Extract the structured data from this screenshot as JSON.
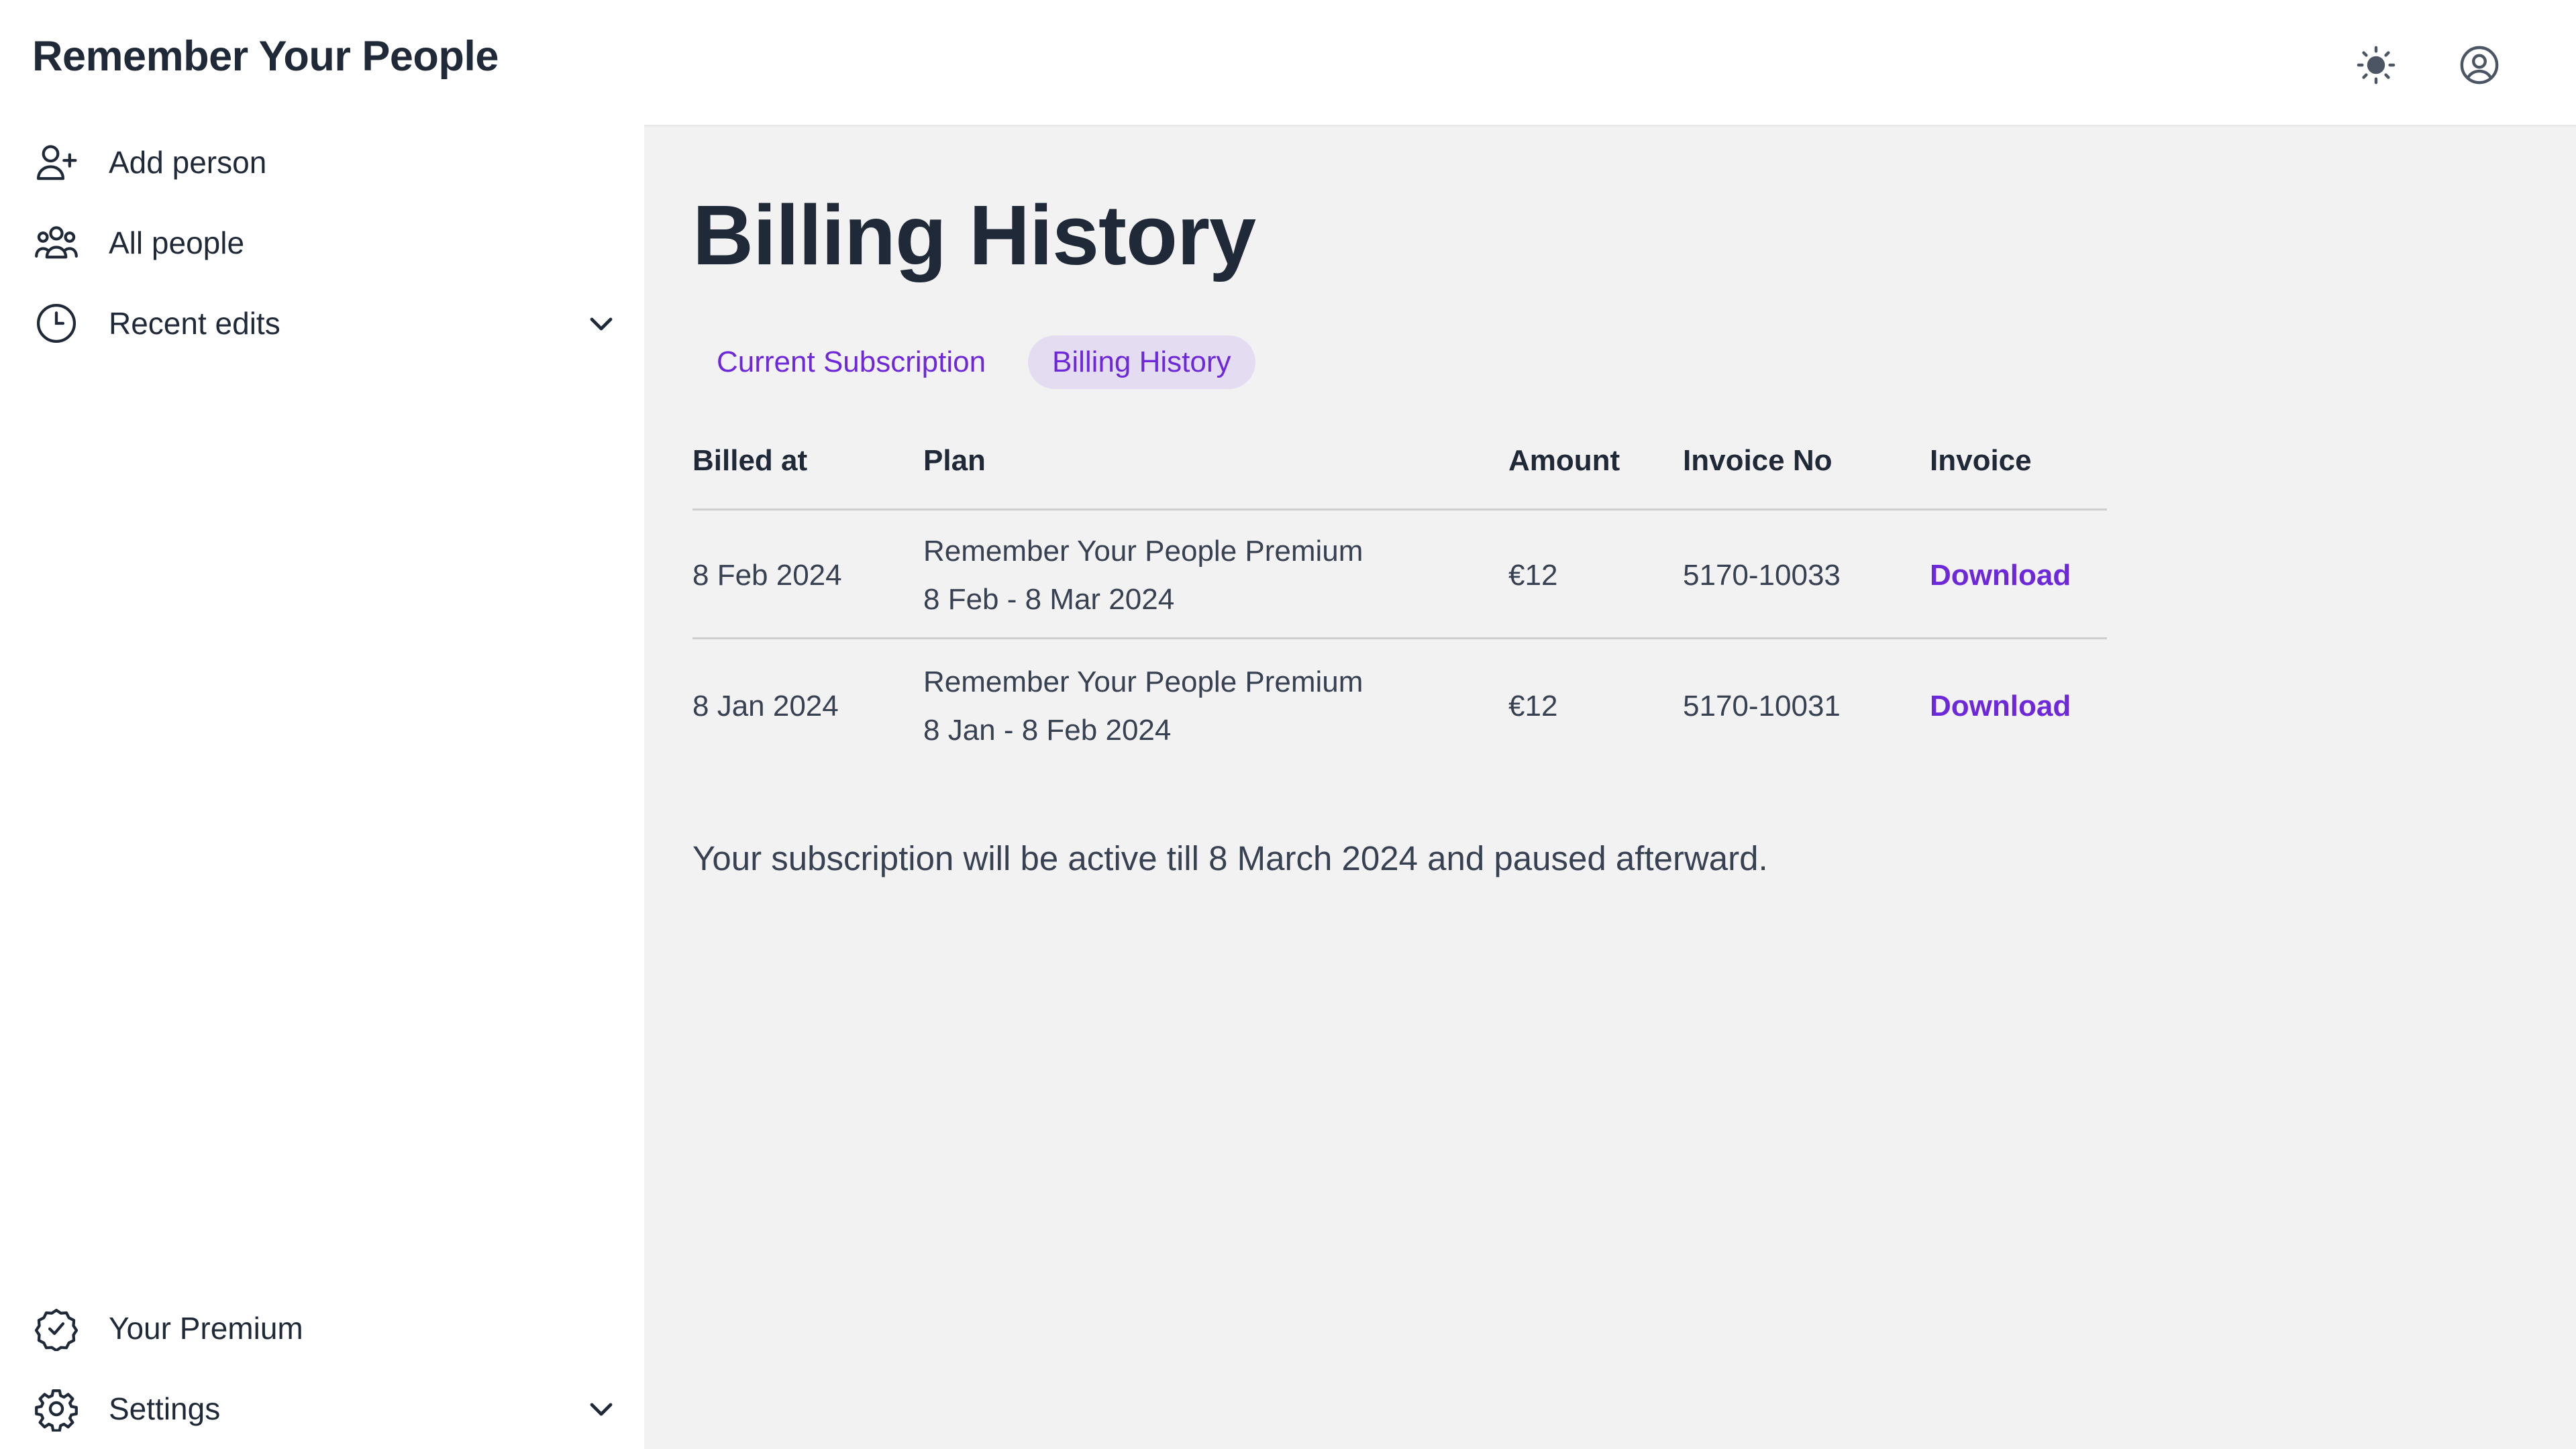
{
  "app": {
    "title": "Remember Your People"
  },
  "header": {
    "icons": [
      "sun-icon",
      "user-circle-icon"
    ]
  },
  "sidebar": {
    "items": [
      {
        "label": "Add person",
        "icon": "user-plus-icon"
      },
      {
        "label": "All people",
        "icon": "users-icon"
      },
      {
        "label": "Recent edits",
        "icon": "clock-icon",
        "expandable": true
      }
    ],
    "bottom_items": [
      {
        "label": "Your Premium",
        "icon": "check-badge-icon"
      },
      {
        "label": "Settings",
        "icon": "gear-icon",
        "expandable": true
      }
    ]
  },
  "main": {
    "title": "Billing History",
    "tabs": [
      {
        "label": "Current Subscription",
        "active": false
      },
      {
        "label": "Billing History",
        "active": true
      }
    ],
    "table": {
      "headers": [
        "Billed at",
        "Plan",
        "Amount",
        "Invoice No",
        "Invoice"
      ],
      "rows": [
        {
          "billed_at": "8 Feb 2024",
          "plan_name": "Remember Your People Premium",
          "plan_period": "8 Feb - 8 Mar 2024",
          "amount": "€12",
          "invoice_no": "5170-10033",
          "invoice": "Download"
        },
        {
          "billed_at": "8 Jan 2024",
          "plan_name": "Remember Your People Premium",
          "plan_period": "8 Jan - 8 Feb 2024",
          "amount": "€12",
          "invoice_no": "5170-10031",
          "invoice": "Download"
        }
      ]
    },
    "notice": "Your subscription will be active till 8 March 2024 and paused afterward."
  },
  "colors": {
    "accent": "#6d28d9",
    "tab_active_bg": "#e4dcf1",
    "main_bg": "#f2f2f2",
    "text": "#1f2937"
  }
}
